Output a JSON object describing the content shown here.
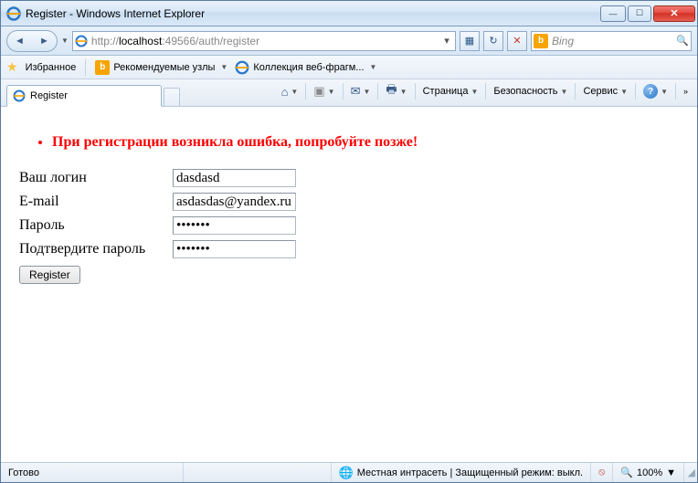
{
  "window": {
    "title": "Register - Windows Internet Explorer"
  },
  "nav": {
    "url_prefix": "http://",
    "url_host": "localhost",
    "url_port_path": ":49566/auth/register"
  },
  "search": {
    "provider": "Bing"
  },
  "favbar": {
    "favorites": "Избранное",
    "recommended": "Рекомендуемые узлы",
    "collection": "Коллекция веб-фрагм..."
  },
  "tabs": {
    "active": "Register"
  },
  "cmd": {
    "page": "Страница",
    "safety": "Безопасность",
    "tools": "Сервис"
  },
  "page": {
    "error": "При регистрации возникла ошибка, попробуйте позже!",
    "labels": {
      "login": "Ваш логин",
      "email": "E-mail",
      "password": "Пароль",
      "confirm": "Подтвердите пароль"
    },
    "values": {
      "login": "dasdasd",
      "email": "asdasdas@yandex.ru",
      "password": "•••••••",
      "confirm": "•••••••"
    },
    "submit": "Register"
  },
  "status": {
    "ready": "Готово",
    "zone": "Местная интрасеть | Защищенный режим: выкл.",
    "zoom": "100%"
  }
}
